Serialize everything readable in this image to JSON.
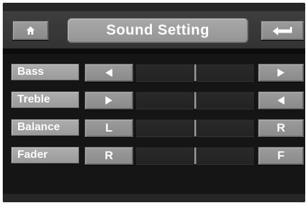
{
  "header": {
    "title": "Sound Setting",
    "home_icon": "home-icon",
    "back_icon": "return-arrow-icon"
  },
  "rows": [
    {
      "label": "Bass",
      "left": {
        "icon": "left-triangle-icon"
      },
      "right": {
        "icon": "right-triangle-icon"
      }
    },
    {
      "label": "Treble",
      "left": {
        "icon": "right-triangle-icon"
      },
      "right": {
        "icon": "left-triangle-icon"
      }
    },
    {
      "label": "Balance",
      "left": {
        "text": "L"
      },
      "right": {
        "text": "R"
      }
    },
    {
      "label": "Fader",
      "left": {
        "text": "R"
      },
      "right": {
        "text": "F"
      }
    }
  ]
}
